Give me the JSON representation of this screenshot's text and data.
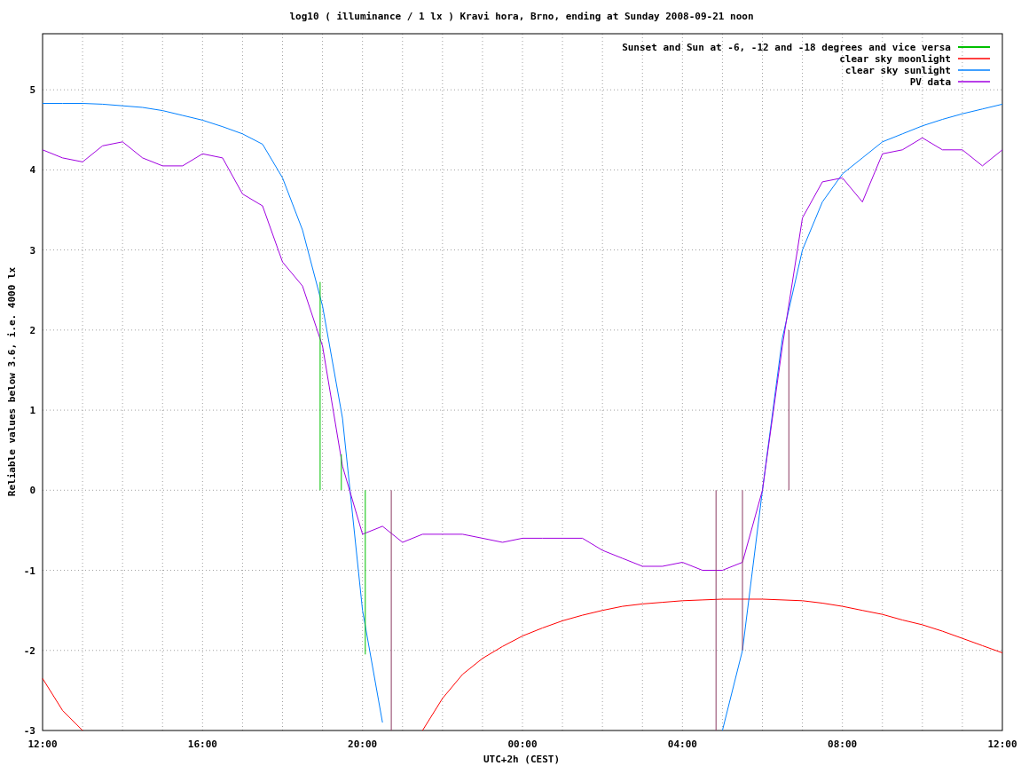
{
  "chart": {
    "chart_data": {
      "type": "line",
      "title": "log10 ( illuminance / 1 lx ) Kravi hora, Brno, ending at Sunday 2008-09-21 noon",
      "xlabel": "UTC+2h (CEST)",
      "ylabel": "Reliable values below 3.6, i.e. 4000 lx",
      "categories": [
        "12:00",
        null,
        null,
        null,
        null,
        null,
        null,
        null,
        "16:00",
        null,
        null,
        null,
        null,
        null,
        null,
        null,
        "20:00",
        null,
        null,
        null,
        null,
        null,
        null,
        null,
        "00:00",
        null,
        null,
        null,
        null,
        null,
        null,
        null,
        "04:00",
        null,
        null,
        null,
        null,
        null,
        null,
        null,
        "08:00",
        null,
        null,
        null,
        null,
        null,
        null,
        null,
        "12:00"
      ],
      "ylim": [
        -3,
        5.7
      ],
      "grid": true,
      "legend": "upper right",
      "yticks": [
        -3,
        -2,
        -1,
        0,
        1,
        2,
        3,
        4,
        5
      ],
      "series": [
        {
          "name": "clear sky moonlight",
          "color": "#ff0000",
          "values": [
            -2.35,
            -2.75,
            -3,
            null,
            null,
            null,
            null,
            null,
            null,
            null,
            null,
            null,
            null,
            null,
            null,
            null,
            null,
            null,
            null,
            -3,
            -2.6,
            -2.3,
            -2.1,
            -1.95,
            -1.82,
            -1.72,
            -1.63,
            -1.56,
            -1.5,
            -1.45,
            -1.42,
            -1.4,
            -1.38,
            -1.37,
            -1.36,
            -1.36,
            -1.36,
            -1.37,
            -1.38,
            -1.41,
            -1.45,
            -1.5,
            -1.55,
            -1.62,
            -1.68,
            -1.76,
            -1.85,
            -1.94,
            -2.03
          ]
        },
        {
          "name": "clear sky sunlight",
          "color": "#0080ff",
          "values": [
            4.83,
            4.83,
            4.83,
            4.82,
            4.8,
            4.78,
            4.74,
            4.68,
            4.62,
            4.54,
            4.45,
            4.32,
            3.9,
            3.25,
            2.3,
            0.9,
            -1.5,
            -2.9,
            null,
            null,
            null,
            null,
            null,
            null,
            null,
            null,
            null,
            null,
            null,
            null,
            null,
            null,
            null,
            null,
            -3,
            -2.0,
            0.0,
            1.9,
            3.0,
            3.6,
            3.95,
            4.15,
            4.35,
            4.45,
            4.55,
            4.63,
            4.7,
            4.76,
            4.82
          ]
        },
        {
          "name": "PV data",
          "color": "#a000e0",
          "values": [
            4.25,
            4.15,
            4.1,
            4.3,
            4.35,
            4.15,
            4.05,
            4.05,
            4.2,
            4.15,
            3.7,
            3.55,
            2.85,
            2.55,
            1.8,
            0.3,
            -0.55,
            -0.45,
            -0.65,
            -0.55,
            -0.55,
            -0.55,
            -0.6,
            -0.65,
            -0.6,
            -0.6,
            -0.6,
            -0.6,
            -0.75,
            -0.85,
            -0.95,
            -0.95,
            -0.9,
            -1.0,
            -1.0,
            -0.9,
            0.0,
            1.8,
            3.4,
            3.85,
            3.9,
            3.6,
            4.2,
            4.25,
            4.4,
            4.25,
            4.25,
            4.05,
            4.25
          ]
        }
      ]
    },
    "marker_legend": {
      "label": "Sunset and Sun at -6, -12 and -18 degrees and vice versa",
      "color": "#00c000"
    }
  }
}
